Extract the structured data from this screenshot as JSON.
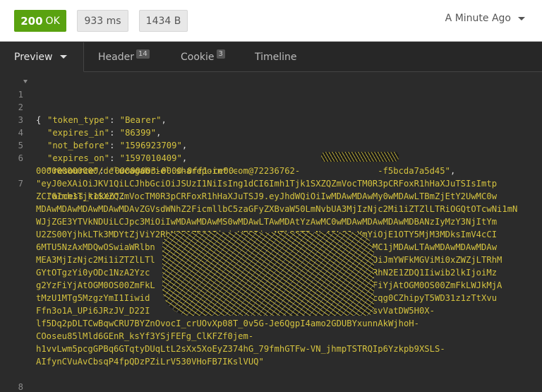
{
  "status": {
    "code": "200",
    "text": "OK",
    "time": "933 ms",
    "size": "1434 B",
    "history": "A Minute Ago"
  },
  "tabs": [
    {
      "label": "Preview"
    },
    {
      "label": "Header",
      "count": "14"
    },
    {
      "label": "Cookie",
      "count": "3"
    },
    {
      "label": "Timeline"
    }
  ],
  "code": {
    "line_numbers": [
      "1",
      "2",
      "3",
      "4",
      "5",
      "6",
      "7",
      "8"
    ],
    "open_brace": "{",
    "close_brace": "}",
    "token_type_key": "\"token_type\"",
    "token_type_val": "\"Bearer\"",
    "expires_in_key": "\"expires_in\"",
    "expires_in_val": "\"86399\"",
    "not_before_key": "\"not_before\"",
    "not_before_val": "\"1596923709\"",
    "expires_on_key": "\"expires_on\"",
    "expires_on_val": "\"1597010409\"",
    "resource_key": "\"resource\"",
    "resource_val_1": "\"00000003-0000-0ff1-ce00-",
    "resource_val_2": "000000000000/delucagabriel.sharepoint.com@72236762-",
    "resource_val_3": "-f5bcda7a5d45\"",
    "access_token_key": "\"access_token\"",
    "access_token_lines": [
      "\"eyJ0eXAiOiJKV1QiLCJhbGciOiJSUzI1NiIsIng1dCI6Imh1Tjk1SXZQZmVocTM0R3pCRFoxR1hHaXJuTSIsImtp",
      "ZCI6Imh1Tjk1SXZQZmVocTM0R3pCRFoxR1hHaXJuTSJ9.eyJhdWQiOiIwMDAwMDAwMy0wMDAwLTBmZjEtY2UwMC0w",
      "MDAwMDAwMDAwMDAwMDAvZGVsdWNhZ2FicmllbC5zaGFyZXBvaW50LmNvbUA3MjIzNjc2Mi1iZTZlLTRiOGQtOTcwNi1mN",
      "WJjZGE3YTVkNDUiLCJpc3MiOiIwMDAwMDAwMS0wMDAwLTAwMDAtYzAwMC0wMDAwMDAwMDAwMDBANzIyMzY3NjItYm",
      "U2ZS00YjhkLTk3MDYtZjViY2RhN2E1ZDQ1IiwiaWF0IjoxNTk2OTIzNzA5LCJuYmYiOjE1OTY5MjM3MDksImV4cCI",
      "6MTU5NzAxMDQwOSwiaWRlbn                                          MC1jMDAwLTAwMDAwMDAwMDAw",
      "MEA3MjIzNjc2Mi1iZTZlLTl                                          OiJmYWFkMGViMi0xZWZjLTRhM",
      "GYtOTgzYi0yODc1NzA2Yzc                                          2RhN2E1ZDQ1Iiwib2lkIjoiMz",
      "g2YzFiYjAtOGM0OS00ZmFkL                                          FiYjAtOGM0OS00ZmFkLWJkMjA",
      "tMzU1MTg5MzgzYmI1Iiwid                                          ycqg0CZhipyT5WD31z1zTtXvu",
      "Ffn3o1A_UPi6JRzJV_D22I                                          osvVatDW5H0X-",
      "lf5Dq2pDLTCwBqwCRU7BYZnOvocI_crUOvXp08T_0v5G-Je6QgpI4amo2GDUBYxunnAkWjhoH-",
      "COoseu85lMld6GEnR_ksYf3YSjFEFg_ClKFZf0jem-",
      "h1vvLwm5pcgGPBq6GTqtyDUqLtL2sXx5XoEyZ374hG_79fmhGTFw-VN_jhmpTSTRQIp6Yzkpb9XSLS-",
      "AIfynCVuAvCbsqP4fpQDzPZiLrV530VHoFB7IKslVUQ\""
    ]
  }
}
